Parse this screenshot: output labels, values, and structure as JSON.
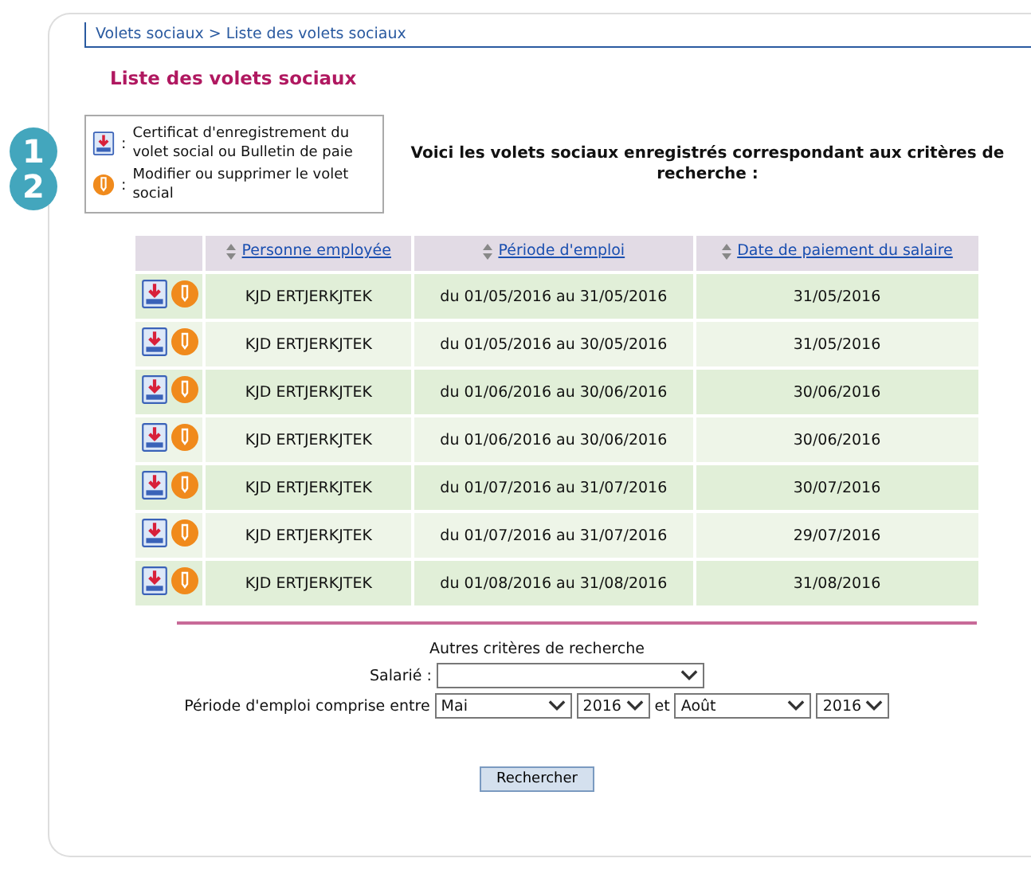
{
  "breadcrumb": "Volets sociaux > Liste des volets sociaux",
  "title": "Liste des volets sociaux",
  "legend": [
    {
      "number": "1",
      "kind": "download",
      "text": "Certificat d'enregistrement du volet social ou Bulletin de paie"
    },
    {
      "number": "2",
      "kind": "edit",
      "text": "Modifier ou supprimer le volet social"
    }
  ],
  "legend_separator": ":",
  "intro": "Voici les volets sociaux enregistrés correspondant aux critères de recherche :",
  "table": {
    "columns": [
      "Personne employée",
      "Période d'emploi",
      "Date de paiement du salaire"
    ],
    "rows": [
      {
        "person": "KJD ERTJERKJTEK",
        "period": "du 01/05/2016 au 31/05/2016",
        "payment_date": "31/05/2016"
      },
      {
        "person": "KJD ERTJERKJTEK",
        "period": "du 01/05/2016 au 30/05/2016",
        "payment_date": "31/05/2016"
      },
      {
        "person": "KJD ERTJERKJTEK",
        "period": "du 01/06/2016 au 30/06/2016",
        "payment_date": "30/06/2016"
      },
      {
        "person": "KJD ERTJERKJTEK",
        "period": "du 01/06/2016 au 30/06/2016",
        "payment_date": "30/06/2016"
      },
      {
        "person": "KJD ERTJERKJTEK",
        "period": "du 01/07/2016 au 31/07/2016",
        "payment_date": "30/07/2016"
      },
      {
        "person": "KJD ERTJERKJTEK",
        "period": "du 01/07/2016 au 31/07/2016",
        "payment_date": "29/07/2016"
      },
      {
        "person": "KJD ERTJERKJTEK",
        "period": "du 01/08/2016 au 31/08/2016",
        "payment_date": "31/08/2016"
      }
    ]
  },
  "search": {
    "heading": "Autres critères de recherche",
    "employee_label": "Salarié :",
    "period_label": "Période d'emploi comprise entre",
    "from_month": "Mai",
    "from_year": "2016",
    "and_label": "et",
    "to_month": "Août",
    "to_year": "2016",
    "button": "Rechercher"
  }
}
